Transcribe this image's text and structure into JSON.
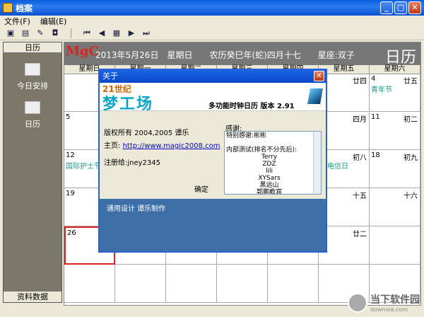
{
  "window": {
    "title": "档案"
  },
  "menu": {
    "items": [
      "文件(F)",
      "编辑(E)"
    ]
  },
  "left": {
    "header": "日历",
    "items": [
      "今日安排",
      "日历"
    ],
    "bottom": "资料数据"
  },
  "calendar": {
    "info": "2013年5月26日　星期日　　农历癸巳年(蛇)四月十七　　星座:双子",
    "big_title": "日历",
    "weekdays": [
      "星期日",
      "星期一",
      "星期二",
      "星期三",
      "星期四",
      "星期五",
      "星期六"
    ],
    "cells": [
      {
        "d": "",
        "l": "",
        "f": ""
      },
      {
        "d": "",
        "l": "",
        "f": ""
      },
      {
        "d": "",
        "l": "",
        "f": ""
      },
      {
        "d": "",
        "l": "",
        "f": ""
      },
      {
        "d": "",
        "l": "",
        "f": ""
      },
      {
        "d": "",
        "l": "廿四",
        "f": ""
      },
      {
        "d": "4",
        "l": "廿五",
        "f": "青年节"
      },
      {
        "d": "5",
        "l": "",
        "f": ""
      },
      {
        "d": "",
        "l": "",
        "f": ""
      },
      {
        "d": "",
        "l": "",
        "f": ""
      },
      {
        "d": "",
        "l": "",
        "f": ""
      },
      {
        "d": "",
        "l": "",
        "f": ""
      },
      {
        "d": "",
        "l": "四月",
        "f": ""
      },
      {
        "d": "11",
        "l": "初二",
        "f": ""
      },
      {
        "d": "12",
        "l": "",
        "f": "国际护士节"
      },
      {
        "d": "",
        "l": "",
        "f": ""
      },
      {
        "d": "",
        "l": "",
        "f": ""
      },
      {
        "d": "",
        "l": "",
        "f": ""
      },
      {
        "d": "",
        "l": "",
        "f": ""
      },
      {
        "d": "",
        "l": "初八",
        "f": "界电信日"
      },
      {
        "d": "18",
        "l": "初九",
        "f": ""
      },
      {
        "d": "19",
        "l": "",
        "f": ""
      },
      {
        "d": "",
        "l": "",
        "f": ""
      },
      {
        "d": "",
        "l": "",
        "f": ""
      },
      {
        "d": "",
        "l": "",
        "f": ""
      },
      {
        "d": "",
        "l": "",
        "f": ""
      },
      {
        "d": "",
        "l": "十五",
        "f": ""
      },
      {
        "d": "",
        "l": "十六",
        "f": ""
      },
      {
        "d": "26",
        "l": "",
        "f": ""
      },
      {
        "d": "",
        "l": "",
        "f": ""
      },
      {
        "d": "",
        "l": "",
        "f": ""
      },
      {
        "d": "",
        "l": "",
        "f": ""
      },
      {
        "d": "",
        "l": "",
        "f": ""
      },
      {
        "d": "",
        "l": "廿二",
        "f": ""
      },
      {
        "d": "",
        "l": "",
        "f": ""
      },
      {
        "d": "",
        "l": "",
        "f": ""
      },
      {
        "d": "",
        "l": "",
        "f": ""
      },
      {
        "d": "",
        "l": "",
        "f": ""
      },
      {
        "d": "",
        "l": "",
        "f": ""
      },
      {
        "d": "",
        "l": "",
        "f": ""
      },
      {
        "d": "",
        "l": "",
        "f": ""
      },
      {
        "d": "",
        "l": "",
        "f": ""
      }
    ]
  },
  "about": {
    "title": "关于",
    "banner_small": "21世纪",
    "banner_big": "梦工场",
    "product": "多功能时钟日历 版本 2.91",
    "copyright": "版权所有 2004,2005 谭乐",
    "homepage_label": "主页:",
    "homepage_url": "http://www.magic2008.com",
    "registered": "注册给:jney2345",
    "ok": "确定",
    "thanks_label": "感谢:",
    "thanks_lines": [
      "特别感谢:彬彬",
      "",
      "内部测试(排名不分先后):",
      "Terry",
      "ZDZ",
      "lili",
      "XYSars",
      "黑远山",
      "郭鹏瞻宾"
    ],
    "footer": "通用设计 谭乐制作"
  },
  "watermark": {
    "text": "当下软件园",
    "sub": "downxia.com"
  },
  "colors": {
    "accent": "#2a5fd6",
    "footer": "#3e6fa6",
    "festival": "#1a9a8a"
  }
}
